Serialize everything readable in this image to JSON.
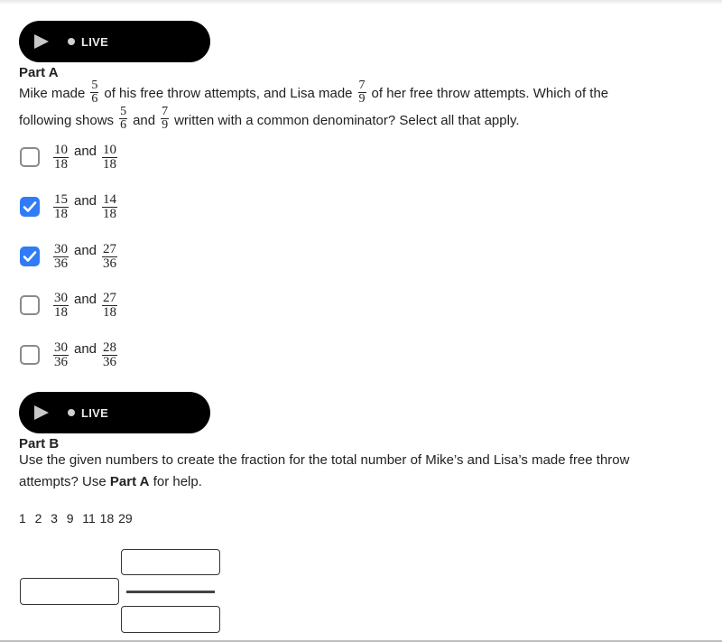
{
  "partA": {
    "live_label": "LIVE",
    "title": "Part A",
    "question": {
      "seg1": "Mike made",
      "frac1": {
        "num": "5",
        "den": "6"
      },
      "seg2": "of his free throw attempts, and Lisa made",
      "frac2": {
        "num": "7",
        "den": "9"
      },
      "seg3": "of her free throw attempts. Which of the following shows",
      "frac3": {
        "num": "5",
        "den": "6"
      },
      "seg4": "and",
      "frac4": {
        "num": "7",
        "den": "9"
      },
      "seg5": "written with a common denominator? Select all that apply."
    },
    "options": [
      {
        "a": {
          "num": "10",
          "den": "18"
        },
        "and": "and",
        "b": {
          "num": "10",
          "den": "18"
        },
        "checked": false
      },
      {
        "a": {
          "num": "15",
          "den": "18"
        },
        "and": "and",
        "b": {
          "num": "14",
          "den": "18"
        },
        "checked": true
      },
      {
        "a": {
          "num": "30",
          "den": "36"
        },
        "and": "and",
        "b": {
          "num": "27",
          "den": "36"
        },
        "checked": true
      },
      {
        "a": {
          "num": "30",
          "den": "18"
        },
        "and": "and",
        "b": {
          "num": "27",
          "den": "18"
        },
        "checked": false
      },
      {
        "a": {
          "num": "30",
          "den": "36"
        },
        "and": "and",
        "b": {
          "num": "28",
          "den": "36"
        },
        "checked": false
      }
    ]
  },
  "partB": {
    "live_label": "LIVE",
    "title": "Part B",
    "question_pre": "Use the given numbers to create the fraction for the total number of Mike’s and Lisa’s made free throw attempts? Use",
    "question_bold": "Part A",
    "question_post": "for help.",
    "numbers": "1  2  3  9  11 18 29",
    "whole_box_value": "",
    "numerator_box_value": "",
    "denominator_box_value": ""
  },
  "colors": {
    "accent": "#2f7cf6",
    "pill": "#000000"
  }
}
